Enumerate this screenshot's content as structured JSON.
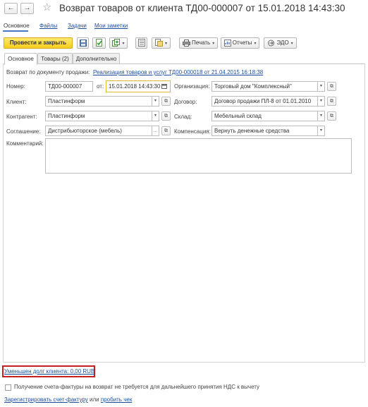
{
  "window": {
    "back_glyph": "←",
    "forward_glyph": "→",
    "star_glyph": "☆",
    "title": "Возврат товаров от клиента ТД00-000007 от 15.01.2018 14:43:30"
  },
  "top_links": {
    "main": "Основное",
    "files": "Файлы",
    "tasks": "Задачи",
    "notes": "Мои заметки"
  },
  "toolbar": {
    "post_close": "Провести и закрыть",
    "dropdown_glyph": "▾",
    "print": "Печать",
    "reports": "Отчеты",
    "edo": "ЭДО"
  },
  "tabs": {
    "main": "Основное",
    "goods": "Товары (2)",
    "extra": "Дополнительно"
  },
  "form": {
    "return_doc_label": "Возврат по документу продажи:",
    "return_doc_link": "Реализация товаров и услуг ТД00-000018 от 21.04.2015 16:18:38",
    "number_label": "Номер:",
    "number_value": "ТД00-000007",
    "date_label": "от:",
    "date_value": "15.01.2018 14:43:30",
    "org_label": "Организация:",
    "org_value": "Торговый дом \"Комплексный\"",
    "client_label": "Клиент:",
    "client_value": "Пластинформ",
    "contract_label": "Договор:",
    "contract_value": "Договор продажи ПЛ-8 от 01.01.2010",
    "counterparty_label": "Контрагент:",
    "counterparty_value": "Пластинформ",
    "warehouse_label": "Склад:",
    "warehouse_value": "Мебельный склад",
    "agreement_label": "Соглашение:",
    "agreement_value": "Дистрибьюторское (мебель)",
    "compensation_label": "Компенсация:",
    "compensation_value": "Вернуть денежные средства",
    "comment_label": "Комментарий:",
    "comment_value": "",
    "select_glyph": "▾",
    "more_glyph": "...",
    "open_glyph": "⧉"
  },
  "footer": {
    "debt_link": "Уменьшен долг клиента: 0,00 RUB",
    "invoice_checkbox_label": "Получение счета-фактуры на возврат не требуется для дальнейшего принятия НДС к вычету",
    "register_invoice_link": "Зарегистрировать счет-фактуру",
    "or_text": "или",
    "punch_receipt_link": "пробить чек"
  },
  "colors": {
    "accent": "#4a76c4",
    "link": "#1f4f9c",
    "primary_button": "#f5ce1e",
    "highlight_box": "#c42020"
  }
}
